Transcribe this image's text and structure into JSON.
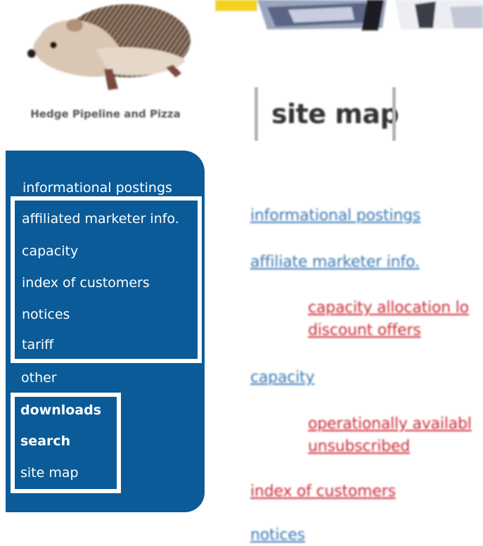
{
  "brand": {
    "name": "Hedge Pipeline and Pizza"
  },
  "nav": {
    "section1_heading": "informational postings",
    "section1_items": [
      "affiliated marketer info.",
      "capacity",
      "index of customers",
      "notices",
      "tariff"
    ],
    "section2_heading": "other",
    "section2_items": [
      "downloads",
      "search",
      "site map"
    ]
  },
  "main": {
    "title": "site map",
    "links": [
      "informational postings",
      "affiliate marketer info.",
      "capacity allocation lo",
      "discount offers",
      "capacity",
      "operationally availabl",
      "unsubscribed",
      "index of customers",
      "notices"
    ]
  },
  "colors": {
    "nav_bg": "#0a5b98",
    "link_blue": "#3a78b4",
    "link_red": "#cc2a35",
    "banner_accent": "#f2d21b"
  }
}
